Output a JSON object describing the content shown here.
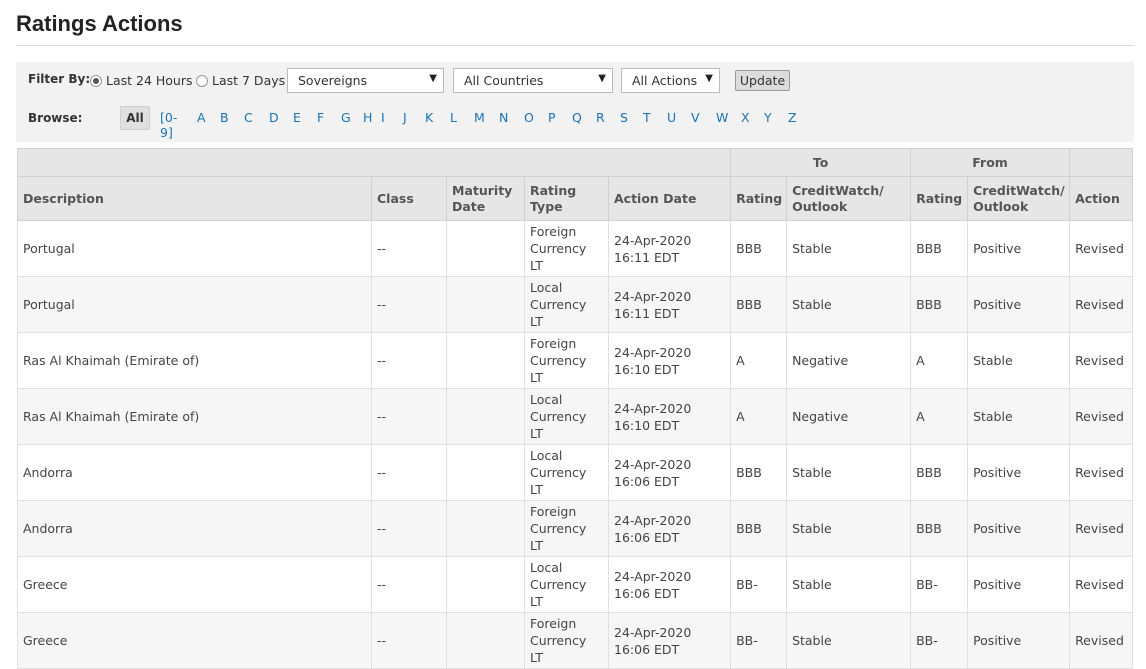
{
  "page": {
    "title": "Ratings Actions"
  },
  "filter": {
    "label": "Filter By:",
    "radio_24h": "Last 24 Hours",
    "radio_7d": "Last 7 Days",
    "selected_radio": "Last 24 Hours",
    "sector_select": "Sovereigns",
    "country_select": "All Countries",
    "action_select": "All Actions",
    "update_label": "Update"
  },
  "browse": {
    "label": "Browse:",
    "all_label": "All",
    "letters": [
      "[0-9]",
      "A",
      "B",
      "C",
      "D",
      "E",
      "F",
      "G",
      "H",
      "I",
      "J",
      "K",
      "L",
      "M",
      "N",
      "O",
      "P",
      "Q",
      "R",
      "S",
      "T",
      "U",
      "V",
      "W",
      "X",
      "Y",
      "Z"
    ]
  },
  "table": {
    "group_to": "To",
    "group_from": "From",
    "headers": {
      "description": "Description",
      "class": "Class",
      "maturity_date": "Maturity Date",
      "rating_type": "Rating Type",
      "action_date": "Action Date",
      "to_rating": "Rating",
      "to_outlook": "CreditWatch/ Outlook",
      "from_rating": "Rating",
      "from_outlook": "CreditWatch/ Outlook",
      "action": "Action"
    },
    "rows": [
      {
        "description": "Portugal",
        "class": "--",
        "maturity": "",
        "rating_type": "Foreign Currency LT",
        "action_date": "24-Apr-2020 16:11 EDT",
        "to_rating": "BBB",
        "to_outlook": "Stable",
        "from_rating": "BBB",
        "from_outlook": "Positive",
        "action": "Revised"
      },
      {
        "description": "Portugal",
        "class": "--",
        "maturity": "",
        "rating_type": "Local Currency LT",
        "action_date": "24-Apr-2020 16:11 EDT",
        "to_rating": "BBB",
        "to_outlook": "Stable",
        "from_rating": "BBB",
        "from_outlook": "Positive",
        "action": "Revised"
      },
      {
        "description": "Ras Al Khaimah (Emirate of)",
        "class": "--",
        "maturity": "",
        "rating_type": "Foreign Currency LT",
        "action_date": "24-Apr-2020 16:10 EDT",
        "to_rating": "A",
        "to_outlook": "Negative",
        "from_rating": "A",
        "from_outlook": "Stable",
        "action": "Revised"
      },
      {
        "description": "Ras Al Khaimah (Emirate of)",
        "class": "--",
        "maturity": "",
        "rating_type": "Local Currency LT",
        "action_date": "24-Apr-2020 16:10 EDT",
        "to_rating": "A",
        "to_outlook": "Negative",
        "from_rating": "A",
        "from_outlook": "Stable",
        "action": "Revised"
      },
      {
        "description": "Andorra",
        "class": "--",
        "maturity": "",
        "rating_type": "Local Currency LT",
        "action_date": "24-Apr-2020 16:06 EDT",
        "to_rating": "BBB",
        "to_outlook": "Stable",
        "from_rating": "BBB",
        "from_outlook": "Positive",
        "action": "Revised"
      },
      {
        "description": "Andorra",
        "class": "--",
        "maturity": "",
        "rating_type": "Foreign Currency LT",
        "action_date": "24-Apr-2020 16:06 EDT",
        "to_rating": "BBB",
        "to_outlook": "Stable",
        "from_rating": "BBB",
        "from_outlook": "Positive",
        "action": "Revised"
      },
      {
        "description": "Greece",
        "class": "--",
        "maturity": "",
        "rating_type": "Local Currency LT",
        "action_date": "24-Apr-2020 16:06 EDT",
        "to_rating": "BB-",
        "to_outlook": "Stable",
        "from_rating": "BB-",
        "from_outlook": "Positive",
        "action": "Revised"
      },
      {
        "description": "Greece",
        "class": "--",
        "maturity": "",
        "rating_type": "Foreign Currency LT",
        "action_date": "24-Apr-2020 16:06 EDT",
        "to_rating": "BB-",
        "to_outlook": "Stable",
        "from_rating": "BB-",
        "from_outlook": "Positive",
        "action": "Revised"
      }
    ]
  }
}
